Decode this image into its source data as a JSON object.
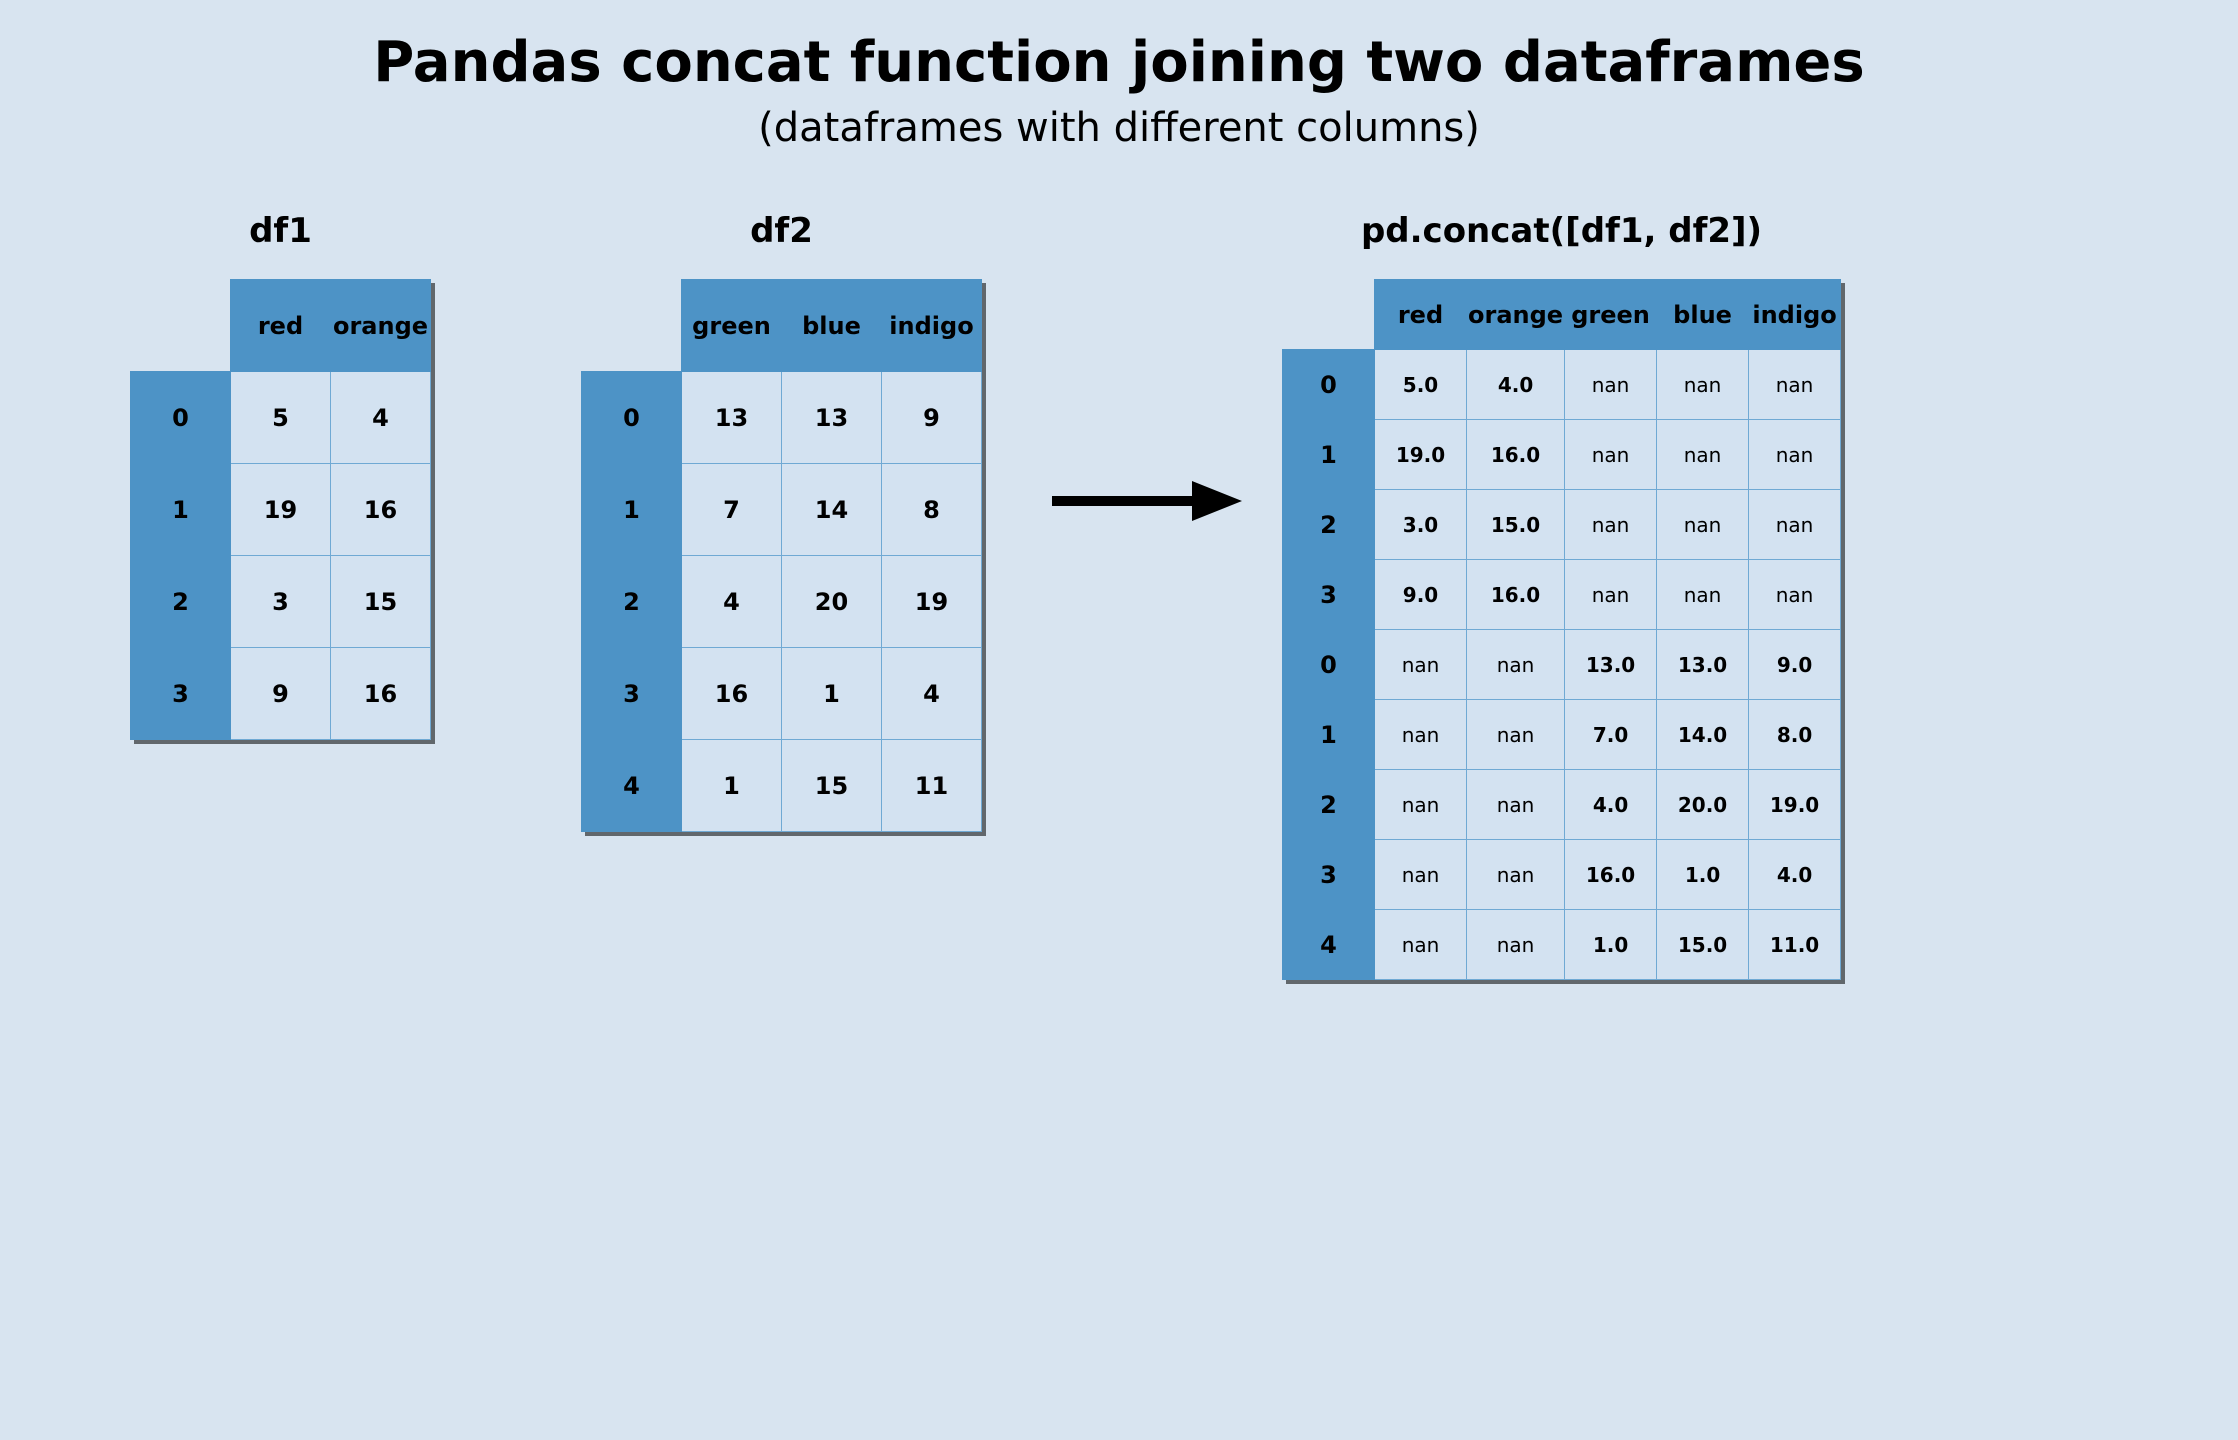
{
  "title": "Pandas concat function joining two dataframes",
  "subtitle": "(dataframes with different columns)",
  "chart_data": {
    "type": "table",
    "tables": [
      {
        "name": "df1",
        "columns": [
          "red",
          "orange"
        ],
        "index": [
          "0",
          "1",
          "2",
          "3"
        ],
        "rows": [
          [
            5,
            4
          ],
          [
            19,
            16
          ],
          [
            3,
            15
          ],
          [
            9,
            16
          ]
        ]
      },
      {
        "name": "df2",
        "columns": [
          "green",
          "blue",
          "indigo"
        ],
        "index": [
          "0",
          "1",
          "2",
          "3",
          "4"
        ],
        "rows": [
          [
            13,
            13,
            9
          ],
          [
            7,
            14,
            8
          ],
          [
            4,
            20,
            19
          ],
          [
            16,
            1,
            4
          ],
          [
            1,
            15,
            11
          ]
        ]
      },
      {
        "name": "pd.concat([df1, df2])",
        "columns": [
          "red",
          "orange",
          "green",
          "blue",
          "indigo"
        ],
        "index": [
          "0",
          "1",
          "2",
          "3",
          "0",
          "1",
          "2",
          "3",
          "4"
        ],
        "rows": [
          [
            "5.0",
            "4.0",
            "nan",
            "nan",
            "nan"
          ],
          [
            "19.0",
            "16.0",
            "nan",
            "nan",
            "nan"
          ],
          [
            "3.0",
            "15.0",
            "nan",
            "nan",
            "nan"
          ],
          [
            "9.0",
            "16.0",
            "nan",
            "nan",
            "nan"
          ],
          [
            "nan",
            "nan",
            "13.0",
            "13.0",
            "9.0"
          ],
          [
            "nan",
            "nan",
            "7.0",
            "14.0",
            "8.0"
          ],
          [
            "nan",
            "nan",
            "4.0",
            "20.0",
            "19.0"
          ],
          [
            "nan",
            "nan",
            "16.0",
            "1.0",
            "4.0"
          ],
          [
            "nan",
            "nan",
            "1.0",
            "15.0",
            "11.0"
          ]
        ]
      }
    ]
  }
}
